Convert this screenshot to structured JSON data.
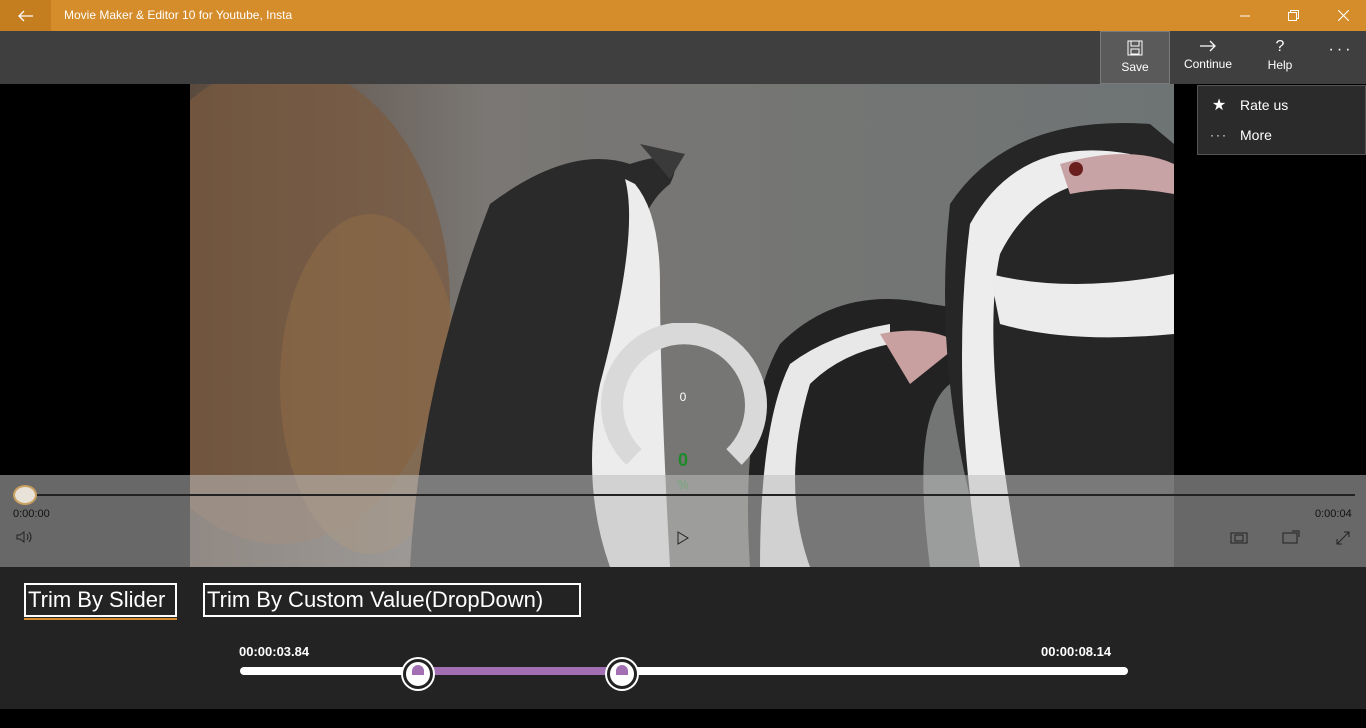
{
  "window": {
    "title": "Movie Maker & Editor 10 for Youtube, Insta",
    "accent": "#d58c2a"
  },
  "commandbar": {
    "save_label": "Save",
    "continue_label": "Continue",
    "help_label": "Help",
    "more_glyph": "···"
  },
  "flyout": {
    "items": [
      {
        "label": "Rate us",
        "icon": "star-icon"
      },
      {
        "label": "More",
        "icon": "ellipsis-icon"
      }
    ]
  },
  "player": {
    "current_time": "0:00:00",
    "total_time": "0:00:04",
    "progress_number": "0",
    "percent_value": "0",
    "percent_symbol": "%"
  },
  "trim": {
    "tabs": [
      {
        "label": "Trim By Slider",
        "selected": true
      },
      {
        "label": "Trim By Custom Value(DropDown)",
        "selected": false
      }
    ],
    "start_label": "00:00:03.84",
    "end_label": "00:00:08.14",
    "start_fraction": 0.2,
    "end_fraction": 0.43,
    "selection_color": "#a26fb3"
  }
}
